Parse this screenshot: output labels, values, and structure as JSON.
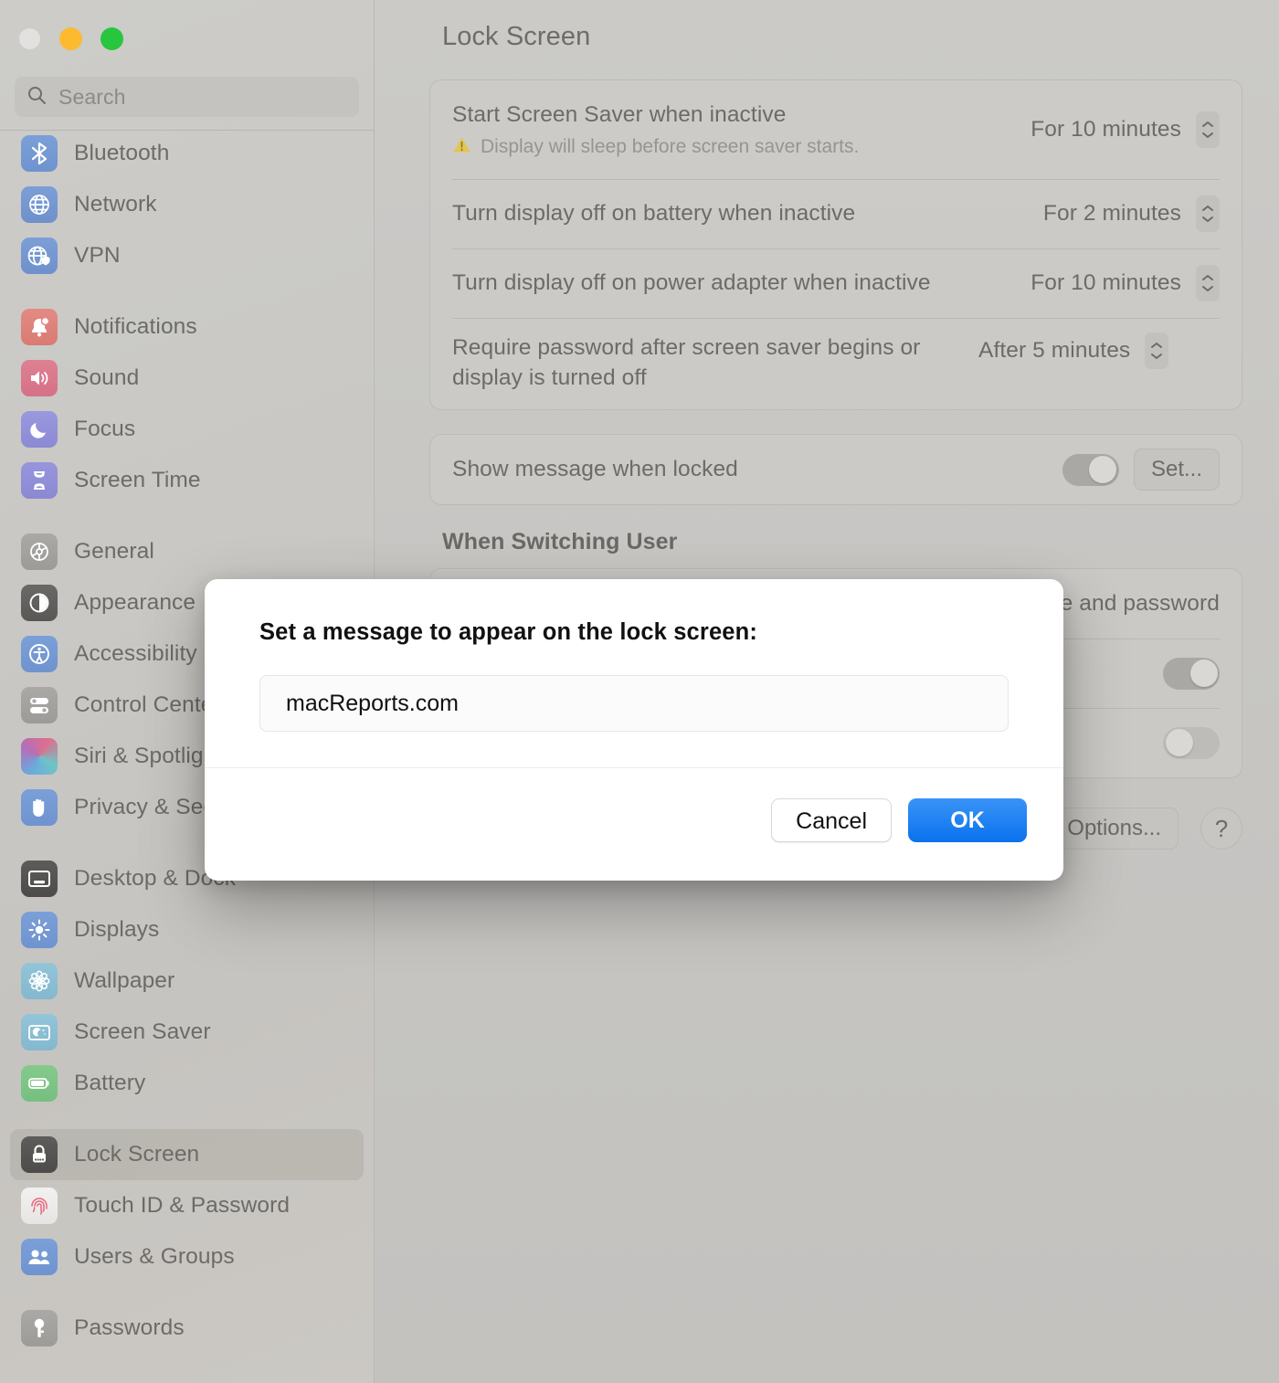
{
  "window": {
    "traffic_lights": [
      "close",
      "minimize",
      "maximize"
    ]
  },
  "sidebar": {
    "search": {
      "placeholder": "Search",
      "value": "",
      "icon": "search-icon"
    },
    "groups": [
      {
        "items": [
          {
            "label": "Bluetooth",
            "icon": "bluetooth-icon",
            "selected": false
          },
          {
            "label": "Network",
            "icon": "globe-icon",
            "selected": false
          },
          {
            "label": "VPN",
            "icon": "globe-shield-icon",
            "selected": false
          }
        ]
      },
      {
        "items": [
          {
            "label": "Notifications",
            "icon": "bell-icon",
            "selected": false
          },
          {
            "label": "Sound",
            "icon": "speaker-icon",
            "selected": false
          },
          {
            "label": "Focus",
            "icon": "moon-icon",
            "selected": false
          },
          {
            "label": "Screen Time",
            "icon": "hourglass-icon",
            "selected": false
          }
        ]
      },
      {
        "items": [
          {
            "label": "General",
            "icon": "gear-icon",
            "selected": false
          },
          {
            "label": "Appearance",
            "icon": "appearance-icon",
            "selected": false
          },
          {
            "label": "Accessibility",
            "icon": "accessibility-icon",
            "selected": false
          },
          {
            "label": "Control Center",
            "icon": "control-center-icon",
            "selected": false
          },
          {
            "label": "Siri & Spotlight",
            "icon": "siri-icon",
            "selected": false
          },
          {
            "label": "Privacy & Security",
            "icon": "hand-icon",
            "selected": false
          }
        ]
      },
      {
        "items": [
          {
            "label": "Desktop & Dock",
            "icon": "desktop-dock-icon",
            "selected": false
          },
          {
            "label": "Displays",
            "icon": "brightness-icon",
            "selected": false
          },
          {
            "label": "Wallpaper",
            "icon": "wallpaper-icon",
            "selected": false
          },
          {
            "label": "Screen Saver",
            "icon": "screen-saver-icon",
            "selected": false
          },
          {
            "label": "Battery",
            "icon": "battery-icon",
            "selected": false
          }
        ]
      },
      {
        "items": [
          {
            "label": "Lock Screen",
            "icon": "lock-icon",
            "selected": true
          },
          {
            "label": "Touch ID & Password",
            "icon": "fingerprint-icon",
            "selected": false
          },
          {
            "label": "Users & Groups",
            "icon": "users-icon",
            "selected": false
          }
        ]
      },
      {
        "items": [
          {
            "label": "Passwords",
            "icon": "key-icon",
            "selected": false
          }
        ]
      }
    ]
  },
  "main": {
    "title": "Lock Screen",
    "card1": [
      {
        "label": "Start Screen Saver when inactive",
        "warning": "Display will sleep before screen saver starts.",
        "warning_icon": "warning-triangle-icon",
        "value": "For 10 minutes",
        "control": "stepper"
      },
      {
        "label": "Turn display off on battery when inactive",
        "value": "For 2 minutes",
        "control": "stepper"
      },
      {
        "label": "Turn display off on power adapter when inactive",
        "value": "For 10 minutes",
        "control": "stepper"
      },
      {
        "label": "Require password after screen saver begins or display is turned off",
        "value": "After 5 minutes",
        "control": "stepper"
      }
    ],
    "card2": [
      {
        "label": "Show message when locked",
        "toggle": "on",
        "button": "Set..."
      }
    ],
    "section_heading": "When Switching User",
    "card3": [
      {
        "label_fragment": "e and password"
      },
      {
        "toggle": "on"
      },
      {
        "toggle": "off"
      }
    ],
    "footer": {
      "options_button": "y Options...",
      "help_button": "?"
    }
  },
  "dialog": {
    "title": "Set a message to appear on the lock screen:",
    "input_value": "macReports.com",
    "input_placeholder": "",
    "cancel_label": "Cancel",
    "ok_label": "OK",
    "accent_color": "#0a72ee"
  }
}
